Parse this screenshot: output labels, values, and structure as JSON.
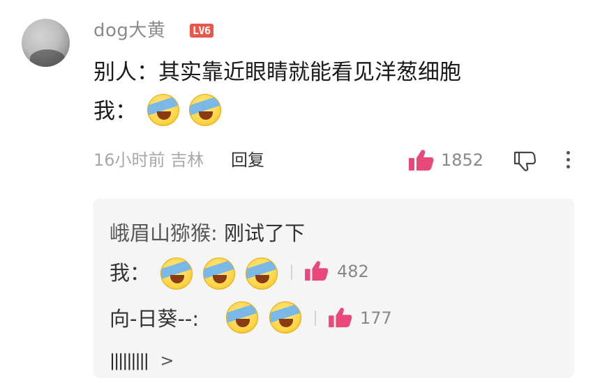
{
  "comment": {
    "username": "dog大黄",
    "level_badge": "LV6",
    "text_line1": "别人：其实靠近眼睛就能看见洋葱细胞",
    "text_line2_prefix": "我：",
    "emoji_name": "laughing-crying-emoji",
    "emoji_count": 2,
    "time": "16小时前",
    "location": "吉林",
    "reply_label": "回复",
    "likes": "1852"
  },
  "replies": [
    {
      "author": "峨眉山猕猴:",
      "text": "刚试了下"
    },
    {
      "author": "",
      "text": "我：",
      "emoji_count": 3,
      "likes": "482"
    },
    {
      "author": "向-日葵--:",
      "text": "",
      "emoji_count": 2,
      "likes": "177"
    }
  ],
  "view_more": {
    "label": "|||||||||",
    "arrow": ">"
  },
  "colors": {
    "like_pink": "#e8497a",
    "badge_red": "#e8574e"
  }
}
